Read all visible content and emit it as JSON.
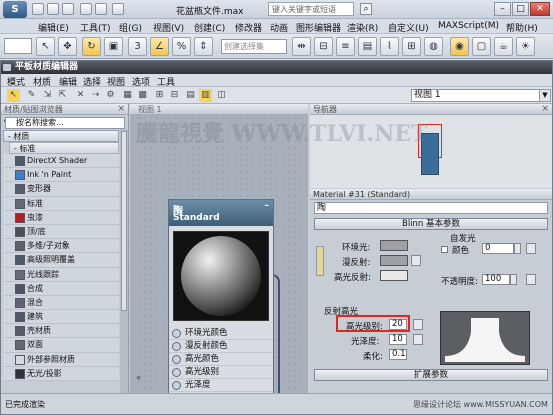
{
  "app": {
    "title": "花盆瓶文件.max",
    "search_placeholder": "键入关键字或短语"
  },
  "main_menu": [
    "编辑(E)",
    "工具(T)",
    "组(G)",
    "视图(V)",
    "创建(C)",
    "修改器",
    "动画",
    "图形编辑器",
    "渲染(R)",
    "自定义(U)",
    "MAXScript(M)",
    "帮助(H)"
  ],
  "main_toolbar": {
    "selection_set_placeholder": "创建选择集",
    "ref_coord": "视图"
  },
  "material_editor": {
    "title": "平板材质编辑器",
    "menu": [
      "模式",
      "材质",
      "编辑",
      "选择",
      "视图",
      "选项",
      "工具"
    ],
    "view_select": "视图 1",
    "browser": {
      "header": "材质/贴图浏览器",
      "search_placeholder": "按名称搜索...",
      "group_materials": "- 材质",
      "subgroup_standard": "- 标准",
      "items": [
        {
          "label": "DirectX Shader",
          "color": "#4f5a66"
        },
        {
          "label": "Ink 'n Paint",
          "color": "#3b7fc4"
        },
        {
          "label": "变形器",
          "color": "#555f69"
        },
        {
          "label": "标准",
          "color": "#606a74"
        },
        {
          "label": "虫漆",
          "color": "#b21d1d"
        },
        {
          "label": "顶/底",
          "color": "#4b4f56"
        },
        {
          "label": "多维/子对象",
          "color": "#5a636c"
        },
        {
          "label": "高级照明覆盖",
          "color": "#4f5a66"
        },
        {
          "label": "光线跟踪",
          "color": "#646c76"
        },
        {
          "label": "合成",
          "color": "#4d5660"
        },
        {
          "label": "混合",
          "color": "#5a6571"
        },
        {
          "label": "建筑",
          "color": "#4f5963"
        },
        {
          "label": "壳材质",
          "color": "#555e68"
        },
        {
          "label": "双面",
          "color": "#616971"
        },
        {
          "label": "外部参照材质",
          "color": "#d4dade"
        },
        {
          "label": "无光/投影",
          "color": "#30343a"
        }
      ]
    },
    "view_tab": "视图 1",
    "node": {
      "name": "陶",
      "type": "Standard",
      "slots": [
        "环境光颜色",
        "漫反射颜色",
        "高光颜色",
        "高光级别",
        "光泽度"
      ]
    },
    "navigator_title": "导航器",
    "props": {
      "header": "Material #31 (Standard)",
      "name_value": "陶",
      "rollout_blinn": "Blinn 基本参数",
      "self_illum": "自发光",
      "color_label": "颜色",
      "color_value": "0",
      "ambient": "环境光:",
      "diffuse": "漫反射:",
      "specular": "高光反射:",
      "opacity": "不透明度:",
      "opacity_value": "100",
      "spec_group": "反射高光",
      "spec_level_label": "高光级别:",
      "spec_level": "20",
      "gloss_label": "光泽度:",
      "gloss": "10",
      "soften_label": "柔化:",
      "soften": "0.1",
      "rollout_ext": "扩展参数"
    },
    "status_text": "已完成渲染",
    "status_right": "思缘设计论坛 www.MISSYUAN.COM"
  },
  "watermark": "騰龍視覺 WWW.TLVI.NET"
}
